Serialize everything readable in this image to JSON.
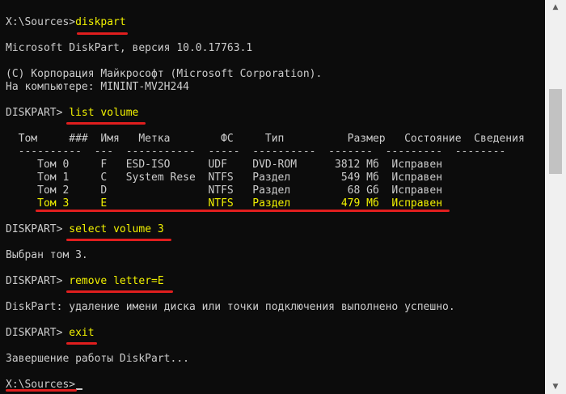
{
  "console": {
    "prompt_start": "X:\\Sources>",
    "cmd_diskpart": "diskpart",
    "banner_version": "Microsoft DiskPart, версия 10.0.17763.1",
    "banner_copyright": "(C) Корпорация Майкрософт (Microsoft Corporation).",
    "banner_computer": "На компьютере: MININT-MV2H244",
    "prompt_diskpart": "DISKPART> ",
    "cmd_list_volume": "list volume",
    "table_header": "  Том     ###  Имя   Метка        ФС     Тип          Размер   Состояние  Сведения",
    "table_separator": "  ----------  ---  -----------  -----  ----------  -------  ---------  --------",
    "table_rows": [
      "     Том 0     F   ESD-ISO      UDF    DVD-ROM      3812 Мб  Исправен",
      "     Том 1     C   System Rese  NTFS   Раздел        549 Мб  Исправен",
      "     Том 2     D                NTFS   Раздел         68 Gб  Исправен",
      "     Том 3     E                NTFS   Раздел        479 Мб  Исправен"
    ],
    "cmd_select": "select volume 3",
    "out_select": "Выбран том 3.",
    "cmd_remove": "remove letter=E",
    "out_remove": "DiskPart: удаление имени диска или точки подключения выполнено успешно.",
    "cmd_exit": "exit",
    "out_exit": "Завершение работы DiskPart...",
    "prompt_end": "X:\\Sources>"
  },
  "colors": {
    "background": "#0c0c0c",
    "text": "#cccccc",
    "highlight": "#f2f200",
    "underline": "#e01e1e"
  },
  "icons": {
    "scroll_up": "arrow-up-icon",
    "scroll_down": "arrow-down-icon"
  }
}
